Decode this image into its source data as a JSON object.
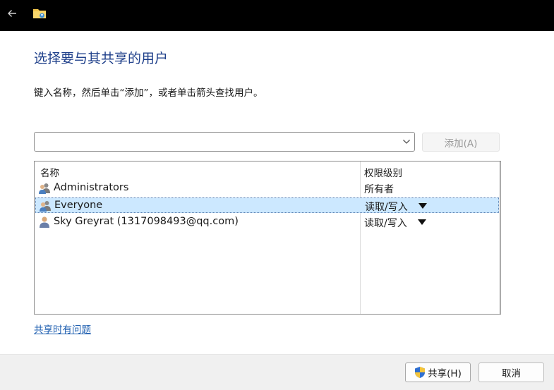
{
  "titlebar": {
    "back_icon": "arrow-left-icon",
    "app_icon": "shared-folder-icon"
  },
  "heading": "选择要与其共享的用户",
  "instruction": "键入名称，然后单击“添加”，或者单击箭头查找用户。",
  "user_input": {
    "value": "",
    "placeholder": ""
  },
  "add_button_label": "添加(A)",
  "list": {
    "columns": [
      "名称",
      "权限级别"
    ],
    "rows": [
      {
        "name": "Administrators",
        "permission": "所有者",
        "icon": "user-group-icon",
        "selected": false,
        "has_dropdown": false
      },
      {
        "name": "Everyone",
        "permission": "读取/写入",
        "icon": "user-group-icon",
        "selected": true,
        "has_dropdown": true
      },
      {
        "name": "Sky Greyrat (1317098493@qq.com)",
        "permission": "读取/写入",
        "icon": "user-icon",
        "selected": false,
        "has_dropdown": true
      }
    ]
  },
  "help_link": "共享时有问题",
  "footer": {
    "share_label": "共享(H)",
    "cancel_label": "取消"
  },
  "colors": {
    "titlebar": "#000000",
    "heading": "#1e3f8a",
    "link": "#1f5fb0",
    "selection": "#cce8ff",
    "footer": "#f0f0f0"
  }
}
